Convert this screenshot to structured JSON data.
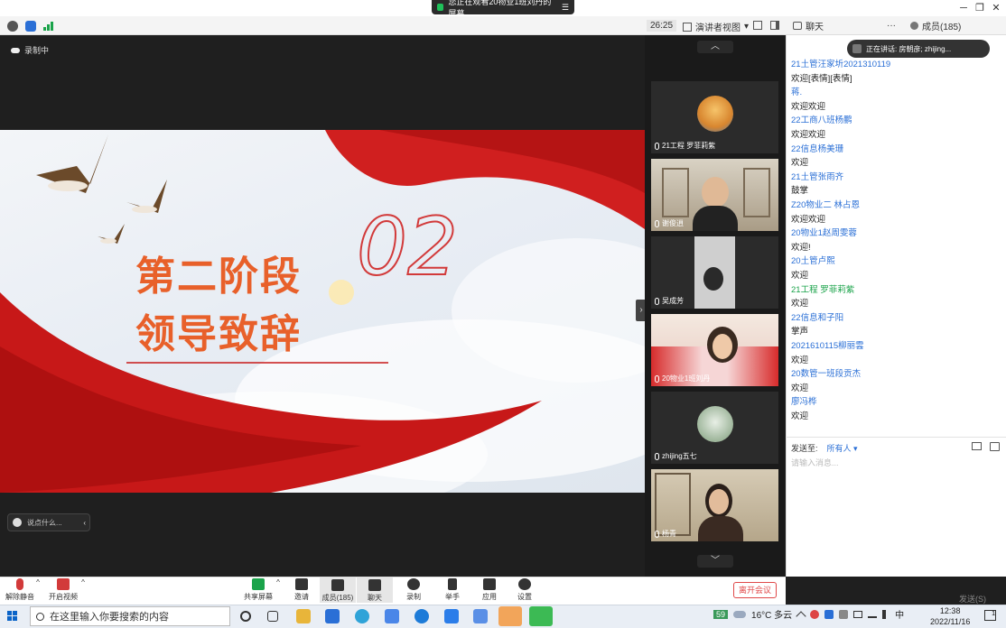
{
  "window": {
    "share_banner": "您正在观看20物业1班刘丹的屏幕",
    "share_menu": "☰",
    "minimize": "─",
    "restore": "❐",
    "close": "✕"
  },
  "toolbar": {
    "timer": "26:25",
    "view_mode": "演讲者视图",
    "dropdown": "▾",
    "icon_colors": {
      "info": "#555555",
      "shield": "#2a6fd6",
      "signal": "#1aa34a"
    }
  },
  "main": {
    "recording_label": "录制中",
    "slide": {
      "title_line1": "第二阶段",
      "title_line2": "领导致辞",
      "number": "02"
    },
    "comment_placeholder": "说点什么...",
    "comment_arrow": "‹",
    "expand_arrow": "›"
  },
  "strip": {
    "up": "︿",
    "down": "﹀",
    "tiles": [
      {
        "name": "21工程 罗菲莉紫"
      },
      {
        "name": "谢俊逍"
      },
      {
        "name": "吴成芳"
      },
      {
        "name": "20物业1班刘丹"
      },
      {
        "name": "zhijing五七"
      },
      {
        "name": "杨青"
      }
    ]
  },
  "chat": {
    "tab_chat": "聊天",
    "tab_more": "···",
    "tab_members": "成员(185)",
    "speaking": "正在讲话: 房朝彦; zhijing...",
    "messages": [
      {
        "text": "21土管汪家圻2021310119",
        "kind": "sender"
      },
      {
        "text": "欢迎[表情][表情]",
        "kind": "body"
      },
      {
        "text": "蒋.",
        "kind": "sender"
      },
      {
        "text": "欢迎欢迎",
        "kind": "body"
      },
      {
        "text": "22工商八班杨鹏",
        "kind": "sender"
      },
      {
        "text": "欢迎欢迎",
        "kind": "body"
      },
      {
        "text": "22信息杨美珊",
        "kind": "sender"
      },
      {
        "text": "欢迎",
        "kind": "body"
      },
      {
        "text": "21土管张雨齐",
        "kind": "sender"
      },
      {
        "text": "鼓掌",
        "kind": "body"
      },
      {
        "text": "Z20物业二 林占恩",
        "kind": "sender"
      },
      {
        "text": "欢迎欢迎",
        "kind": "body"
      },
      {
        "text": "20物业1赵周雯蓉",
        "kind": "sender"
      },
      {
        "text": "欢迎!",
        "kind": "body"
      },
      {
        "text": "20土管卢熙",
        "kind": "sender"
      },
      {
        "text": "欢迎",
        "kind": "body"
      },
      {
        "text": "21工程 罗菲莉紫",
        "kind": "sender-green"
      },
      {
        "text": "欢迎",
        "kind": "body"
      },
      {
        "text": "22信息和子阳",
        "kind": "sender"
      },
      {
        "text": "掌声",
        "kind": "body"
      },
      {
        "text": "2021610115柳丽雲",
        "kind": "sender"
      },
      {
        "text": "欢迎",
        "kind": "body"
      },
      {
        "text": "20数管一班段贡杰",
        "kind": "sender"
      },
      {
        "text": "欢迎",
        "kind": "body"
      },
      {
        "text": "廖冯桦",
        "kind": "sender"
      },
      {
        "text": "欢迎",
        "kind": "body"
      }
    ],
    "send_to_label": "发送至:",
    "send_to_target": "所有人 ▾",
    "input_placeholder": "请输入消息...",
    "send_button": "发送(S)"
  },
  "controls": {
    "mute": "解除静音",
    "video": "开启视频",
    "share": "共享屏幕",
    "invite": "邀请",
    "members": "成员(185)",
    "chat": "聊天",
    "record": "录制",
    "hand": "举手",
    "apps": "应用",
    "settings": "设置",
    "leave": "离开会议",
    "caret": "^"
  },
  "taskbar": {
    "search_placeholder": "在这里输入你要搜索的内容",
    "battery": "59",
    "weather": "16°C 多云",
    "ime": "中",
    "time": "12:38",
    "date": "2022/11/16",
    "notification": "1"
  }
}
